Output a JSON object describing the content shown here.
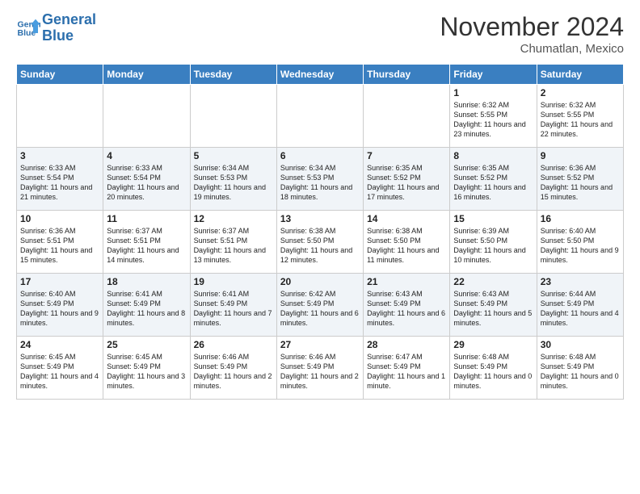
{
  "header": {
    "logo_line1": "General",
    "logo_line2": "Blue",
    "month_title": "November 2024",
    "location": "Chumatlan, Mexico"
  },
  "days_of_week": [
    "Sunday",
    "Monday",
    "Tuesday",
    "Wednesday",
    "Thursday",
    "Friday",
    "Saturday"
  ],
  "weeks": [
    [
      {
        "day": "",
        "info": ""
      },
      {
        "day": "",
        "info": ""
      },
      {
        "day": "",
        "info": ""
      },
      {
        "day": "",
        "info": ""
      },
      {
        "day": "",
        "info": ""
      },
      {
        "day": "1",
        "info": "Sunrise: 6:32 AM\nSunset: 5:55 PM\nDaylight: 11 hours and 23 minutes."
      },
      {
        "day": "2",
        "info": "Sunrise: 6:32 AM\nSunset: 5:55 PM\nDaylight: 11 hours and 22 minutes."
      }
    ],
    [
      {
        "day": "3",
        "info": "Sunrise: 6:33 AM\nSunset: 5:54 PM\nDaylight: 11 hours and 21 minutes."
      },
      {
        "day": "4",
        "info": "Sunrise: 6:33 AM\nSunset: 5:54 PM\nDaylight: 11 hours and 20 minutes."
      },
      {
        "day": "5",
        "info": "Sunrise: 6:34 AM\nSunset: 5:53 PM\nDaylight: 11 hours and 19 minutes."
      },
      {
        "day": "6",
        "info": "Sunrise: 6:34 AM\nSunset: 5:53 PM\nDaylight: 11 hours and 18 minutes."
      },
      {
        "day": "7",
        "info": "Sunrise: 6:35 AM\nSunset: 5:52 PM\nDaylight: 11 hours and 17 minutes."
      },
      {
        "day": "8",
        "info": "Sunrise: 6:35 AM\nSunset: 5:52 PM\nDaylight: 11 hours and 16 minutes."
      },
      {
        "day": "9",
        "info": "Sunrise: 6:36 AM\nSunset: 5:52 PM\nDaylight: 11 hours and 15 minutes."
      }
    ],
    [
      {
        "day": "10",
        "info": "Sunrise: 6:36 AM\nSunset: 5:51 PM\nDaylight: 11 hours and 15 minutes."
      },
      {
        "day": "11",
        "info": "Sunrise: 6:37 AM\nSunset: 5:51 PM\nDaylight: 11 hours and 14 minutes."
      },
      {
        "day": "12",
        "info": "Sunrise: 6:37 AM\nSunset: 5:51 PM\nDaylight: 11 hours and 13 minutes."
      },
      {
        "day": "13",
        "info": "Sunrise: 6:38 AM\nSunset: 5:50 PM\nDaylight: 11 hours and 12 minutes."
      },
      {
        "day": "14",
        "info": "Sunrise: 6:38 AM\nSunset: 5:50 PM\nDaylight: 11 hours and 11 minutes."
      },
      {
        "day": "15",
        "info": "Sunrise: 6:39 AM\nSunset: 5:50 PM\nDaylight: 11 hours and 10 minutes."
      },
      {
        "day": "16",
        "info": "Sunrise: 6:40 AM\nSunset: 5:50 PM\nDaylight: 11 hours and 9 minutes."
      }
    ],
    [
      {
        "day": "17",
        "info": "Sunrise: 6:40 AM\nSunset: 5:49 PM\nDaylight: 11 hours and 9 minutes."
      },
      {
        "day": "18",
        "info": "Sunrise: 6:41 AM\nSunset: 5:49 PM\nDaylight: 11 hours and 8 minutes."
      },
      {
        "day": "19",
        "info": "Sunrise: 6:41 AM\nSunset: 5:49 PM\nDaylight: 11 hours and 7 minutes."
      },
      {
        "day": "20",
        "info": "Sunrise: 6:42 AM\nSunset: 5:49 PM\nDaylight: 11 hours and 6 minutes."
      },
      {
        "day": "21",
        "info": "Sunrise: 6:43 AM\nSunset: 5:49 PM\nDaylight: 11 hours and 6 minutes."
      },
      {
        "day": "22",
        "info": "Sunrise: 6:43 AM\nSunset: 5:49 PM\nDaylight: 11 hours and 5 minutes."
      },
      {
        "day": "23",
        "info": "Sunrise: 6:44 AM\nSunset: 5:49 PM\nDaylight: 11 hours and 4 minutes."
      }
    ],
    [
      {
        "day": "24",
        "info": "Sunrise: 6:45 AM\nSunset: 5:49 PM\nDaylight: 11 hours and 4 minutes."
      },
      {
        "day": "25",
        "info": "Sunrise: 6:45 AM\nSunset: 5:49 PM\nDaylight: 11 hours and 3 minutes."
      },
      {
        "day": "26",
        "info": "Sunrise: 6:46 AM\nSunset: 5:49 PM\nDaylight: 11 hours and 2 minutes."
      },
      {
        "day": "27",
        "info": "Sunrise: 6:46 AM\nSunset: 5:49 PM\nDaylight: 11 hours and 2 minutes."
      },
      {
        "day": "28",
        "info": "Sunrise: 6:47 AM\nSunset: 5:49 PM\nDaylight: 11 hours and 1 minute."
      },
      {
        "day": "29",
        "info": "Sunrise: 6:48 AM\nSunset: 5:49 PM\nDaylight: 11 hours and 0 minutes."
      },
      {
        "day": "30",
        "info": "Sunrise: 6:48 AM\nSunset: 5:49 PM\nDaylight: 11 hours and 0 minutes."
      }
    ]
  ]
}
